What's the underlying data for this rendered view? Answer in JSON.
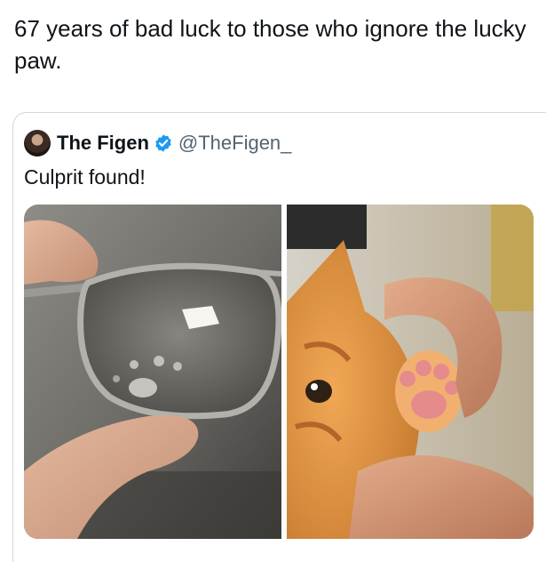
{
  "post": {
    "text": "67 years of bad luck to those who ignore the lucky paw."
  },
  "quoted_post": {
    "author_name": "The Figen",
    "author_handle": "@TheFigen_",
    "verified": true,
    "text": "Culprit found!",
    "media": [
      {
        "icon": "glasses-with-paw-print-photo"
      },
      {
        "icon": "orange-kitten-paw-photo"
      }
    ]
  },
  "colors": {
    "text": "#0f1419",
    "secondary": "#536471",
    "border": "#cfd9de",
    "verified_blue": "#1d9bf0",
    "kitten_orange": "#d98a3a"
  }
}
